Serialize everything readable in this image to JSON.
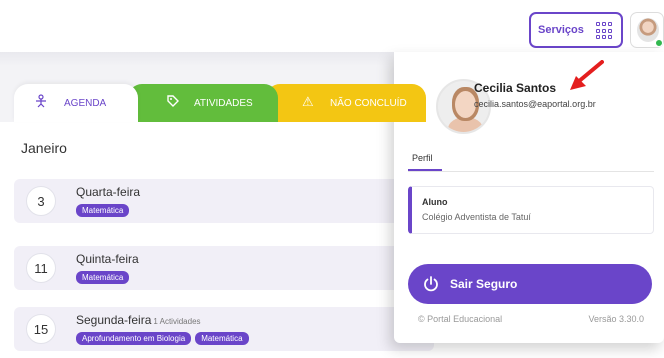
{
  "header": {
    "services_label": "Serviços"
  },
  "tabs": [
    {
      "label": "AGENDA",
      "icon": "agenda-person-icon"
    },
    {
      "label": "ATIVIDADES",
      "icon": "tag-icon"
    },
    {
      "label": "NÃO CONCLUÍD",
      "icon": "warning-icon"
    }
  ],
  "calendar": {
    "month": "Janeiro",
    "days": [
      {
        "number": "3",
        "weekday": "Quarta-feira",
        "count": "",
        "tags": [
          "Matemática"
        ]
      },
      {
        "number": "11",
        "weekday": "Quinta-feira",
        "count": "",
        "tags": [
          "Matemática"
        ]
      },
      {
        "number": "15",
        "weekday": "Segunda-feira",
        "count": "1 Actividades",
        "tags": [
          "Aprofundamento em Biologia",
          "Matemática"
        ]
      }
    ]
  },
  "profile_panel": {
    "name": "Cecilia Santos",
    "email": "cecilia.santos@eaportal.org.br",
    "tab_label": "Perfil",
    "role": "Aluno",
    "school": "Colégio Adventista de Tatuí",
    "logout_label": "Sair Seguro",
    "footer_left": "© Portal Educacional",
    "footer_right": "Versão 3.30.0"
  },
  "colors": {
    "accent": "#6a45c9",
    "agenda_tab": "#ffffff",
    "activities_tab": "#62bd3c",
    "incomplete_tab": "#f3c613",
    "annotation_arrow": "#e41e1e",
    "online": "#31b84f"
  }
}
